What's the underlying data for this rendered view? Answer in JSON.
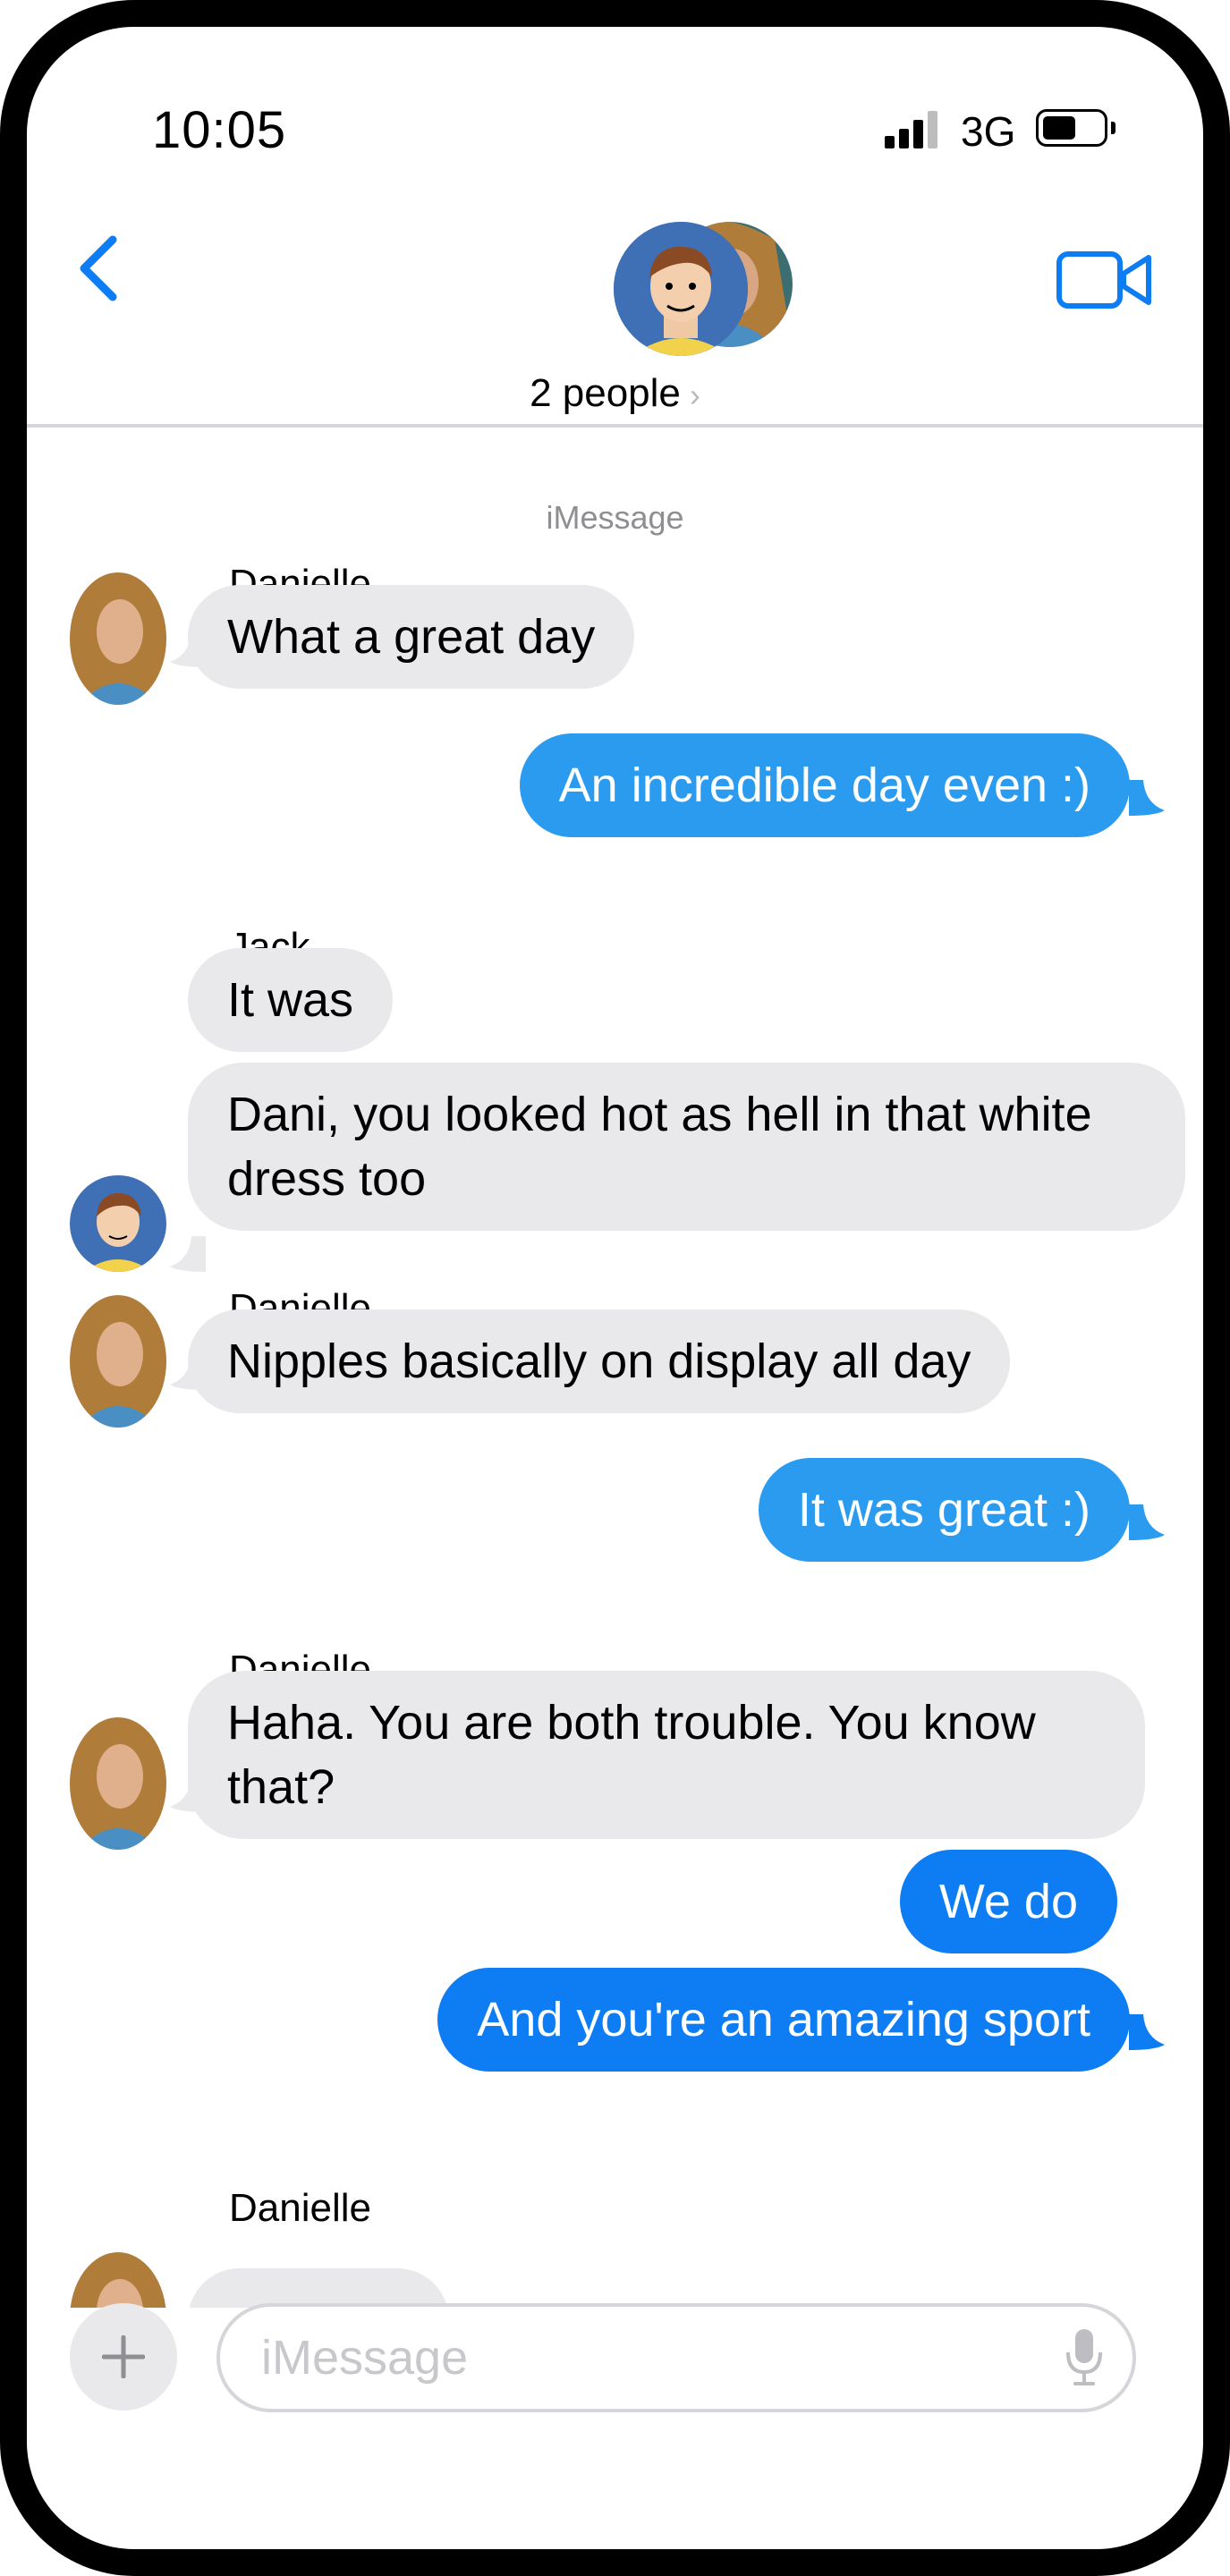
{
  "status_bar": {
    "time": "10:05",
    "network": "3G"
  },
  "header": {
    "people_label": "2 people",
    "chevron": "›"
  },
  "thread": {
    "service_label": "iMessage",
    "messages": [
      {
        "sender": "Danielle",
        "text": "What a great day",
        "direction": "incoming"
      },
      {
        "text": "An incredible day even :)",
        "direction": "outgoing"
      },
      {
        "sender": "Jack",
        "text": "It was",
        "direction": "incoming"
      },
      {
        "text": "Dani, you looked hot as hell in that white dress too",
        "direction": "incoming"
      },
      {
        "sender": "Danielle",
        "text": "Nipples basically on display all day",
        "direction": "incoming"
      },
      {
        "text": "It was great :)",
        "direction": "outgoing"
      },
      {
        "sender": "Danielle",
        "text": "Haha.  You are both trouble.  You know that?",
        "direction": "incoming"
      },
      {
        "text": "We do",
        "direction": "outgoing"
      },
      {
        "text": "And you're an amazing sport",
        "direction": "outgoing"
      },
      {
        "sender": "Danielle",
        "text": "",
        "direction": "incoming"
      }
    ]
  },
  "composer": {
    "placeholder": "iMessage"
  },
  "icons": {
    "back": "chevron-left-icon",
    "video": "video-camera-icon",
    "plus": "plus-icon",
    "mic": "microphone-icon"
  },
  "colors": {
    "accent": "#0e7cf2",
    "outgoing_bubble": "#2b9bf0",
    "incoming_bubble": "#e9e9eb"
  }
}
